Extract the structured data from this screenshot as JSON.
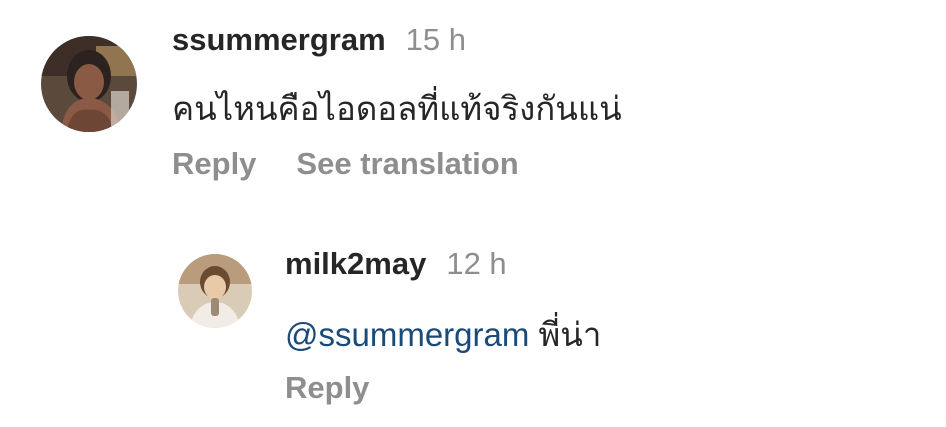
{
  "comments": [
    {
      "username": "ssummergram",
      "time": "15 h",
      "text": "คนไหนคือไอดอลที่แท้จริงกันแน่",
      "actions": {
        "reply": "Reply",
        "translate": "See translation"
      },
      "avatar": "anime-character-avatar"
    },
    {
      "username": "milk2may",
      "time": "12 h",
      "mention": "@ssummergram",
      "text": "พี่น่า",
      "actions": {
        "reply": "Reply"
      },
      "avatar": "person-photo-avatar"
    }
  ],
  "colors": {
    "username": "#262626",
    "secondary": "#8e8e8e",
    "mention": "#1a4a7a"
  }
}
